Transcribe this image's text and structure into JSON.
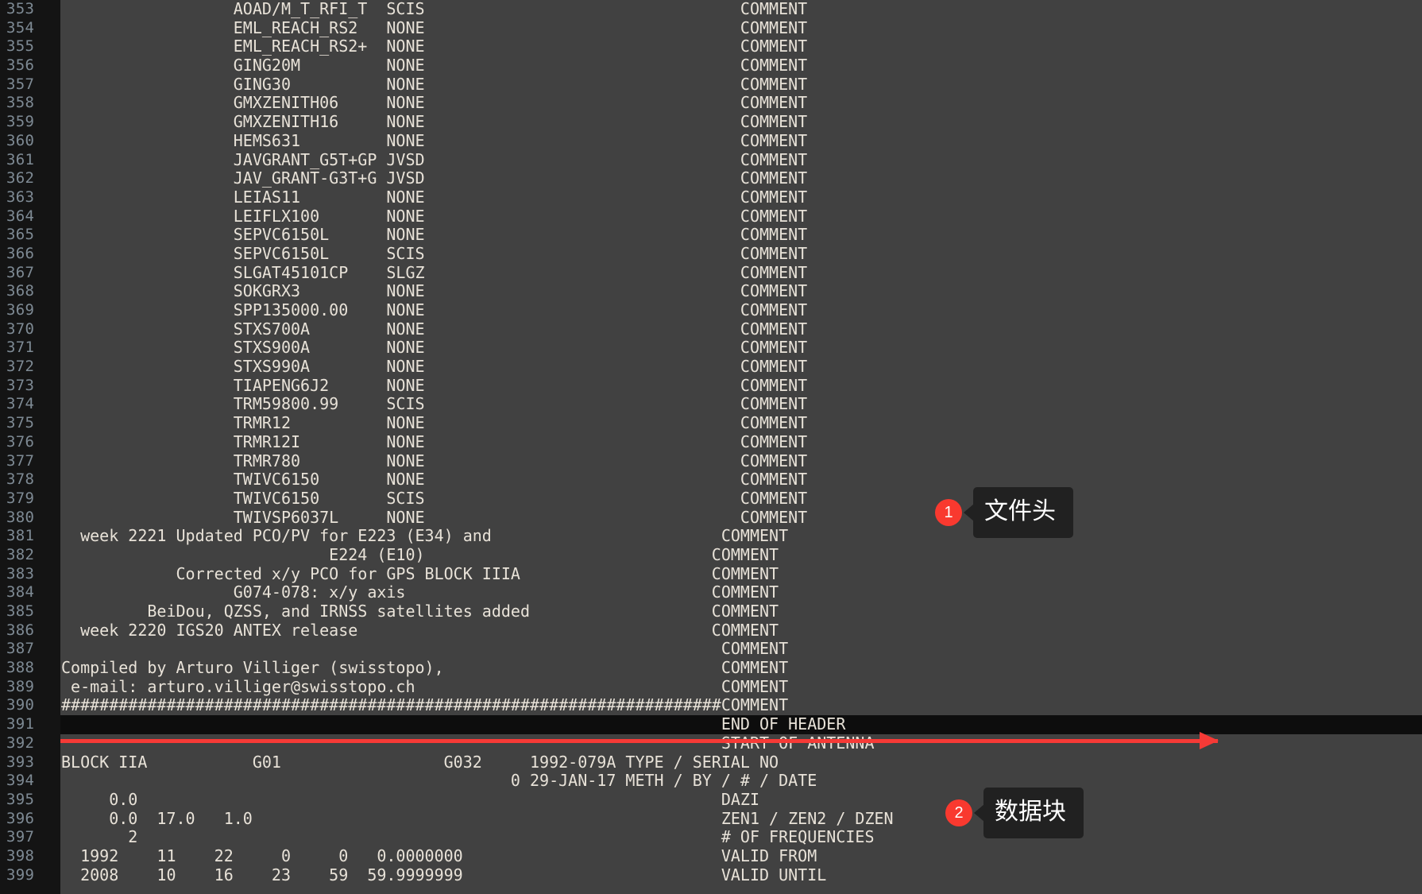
{
  "editor": {
    "first_line_number": 353,
    "gutter_color": "#141414",
    "background_color": "#414141",
    "text_color": "#e8e2d8",
    "line_number_color": "#7e8a94",
    "current_line": 391,
    "lines": [
      {
        "n": 353,
        "text": "                  AOAD/M_T_RFI_T  SCIS                                 COMMENT"
      },
      {
        "n": 354,
        "text": "                  EML_REACH_RS2   NONE                                 COMMENT"
      },
      {
        "n": 355,
        "text": "                  EML_REACH_RS2+  NONE                                 COMMENT"
      },
      {
        "n": 356,
        "text": "                  GING20M         NONE                                 COMMENT"
      },
      {
        "n": 357,
        "text": "                  GING30          NONE                                 COMMENT"
      },
      {
        "n": 358,
        "text": "                  GMXZENITH06     NONE                                 COMMENT"
      },
      {
        "n": 359,
        "text": "                  GMXZENITH16     NONE                                 COMMENT"
      },
      {
        "n": 360,
        "text": "                  HEMS631         NONE                                 COMMENT"
      },
      {
        "n": 361,
        "text": "                  JAVGRANT_G5T+GP JVSD                                 COMMENT"
      },
      {
        "n": 362,
        "text": "                  JAV_GRANT-G3T+G JVSD                                 COMMENT"
      },
      {
        "n": 363,
        "text": "                  LEIAS11         NONE                                 COMMENT"
      },
      {
        "n": 364,
        "text": "                  LEIFLX100       NONE                                 COMMENT"
      },
      {
        "n": 365,
        "text": "                  SEPVC6150L      NONE                                 COMMENT"
      },
      {
        "n": 366,
        "text": "                  SEPVC6150L      SCIS                                 COMMENT"
      },
      {
        "n": 367,
        "text": "                  SLGAT45101CP    SLGZ                                 COMMENT"
      },
      {
        "n": 368,
        "text": "                  SOKGRX3         NONE                                 COMMENT"
      },
      {
        "n": 369,
        "text": "                  SPP135000.00    NONE                                 COMMENT"
      },
      {
        "n": 370,
        "text": "                  STXS700A        NONE                                 COMMENT"
      },
      {
        "n": 371,
        "text": "                  STXS900A        NONE                                 COMMENT"
      },
      {
        "n": 372,
        "text": "                  STXS990A        NONE                                 COMMENT"
      },
      {
        "n": 373,
        "text": "                  TIAPENG6J2      NONE                                 COMMENT"
      },
      {
        "n": 374,
        "text": "                  TRM59800.99     SCIS                                 COMMENT"
      },
      {
        "n": 375,
        "text": "                  TRMR12          NONE                                 COMMENT"
      },
      {
        "n": 376,
        "text": "                  TRMR12I         NONE                                 COMMENT"
      },
      {
        "n": 377,
        "text": "                  TRMR780         NONE                                 COMMENT"
      },
      {
        "n": 378,
        "text": "                  TWIVC6150       NONE                                 COMMENT"
      },
      {
        "n": 379,
        "text": "                  TWIVC6150       SCIS                                 COMMENT"
      },
      {
        "n": 380,
        "text": "                  TWIVSP6037L     NONE                                 COMMENT"
      },
      {
        "n": 381,
        "text": "  week 2221 Updated PCO/PV for E223 (E34) and                        COMMENT"
      },
      {
        "n": 382,
        "text": "                            E224 (E10)                              COMMENT"
      },
      {
        "n": 383,
        "text": "            Corrected x/y PCO for GPS BLOCK IIIA                    COMMENT"
      },
      {
        "n": 384,
        "text": "                  G074-078: x/y axis                                COMMENT"
      },
      {
        "n": 385,
        "text": "         BeiDou, QZSS, and IRNSS satellites added                   COMMENT"
      },
      {
        "n": 386,
        "text": "  week 2220 IGS20 ANTEX release                                     COMMENT"
      },
      {
        "n": 387,
        "text": "                                                                     COMMENT"
      },
      {
        "n": 388,
        "text": "Compiled by Arturo Villiger (swisstopo),                             COMMENT"
      },
      {
        "n": 389,
        "text": " e-mail: arturo.villiger@swisstopo.ch                                COMMENT"
      },
      {
        "n": 390,
        "text": "#####################################################################COMMENT"
      },
      {
        "n": 391,
        "text": "                                                                     END OF HEADER"
      },
      {
        "n": 392,
        "text": "                                                                     START OF ANTENNA"
      },
      {
        "n": 393,
        "text": "BLOCK IIA           G01                 G032     1992-079A TYPE / SERIAL NO"
      },
      {
        "n": 394,
        "text": "                                               0 29-JAN-17 METH / BY / # / DATE"
      },
      {
        "n": 395,
        "text": "     0.0                                                             DAZI"
      },
      {
        "n": 396,
        "text": "     0.0  17.0   1.0                                                 ZEN1 / ZEN2 / DZEN"
      },
      {
        "n": 397,
        "text": "       2                                                             # OF FREQUENCIES"
      },
      {
        "n": 398,
        "text": "  1992    11    22     0     0   0.0000000                           VALID FROM"
      },
      {
        "n": 399,
        "text": "  2008    10    16    23    59  59.9999999                           VALID UNTIL"
      }
    ]
  },
  "annotations": {
    "arrow": {
      "name": "red-underline-arrow",
      "color": "#f63a36",
      "points_to_line": 391
    },
    "callouts": [
      {
        "number": "1",
        "label": "文件头",
        "badge_color": "#f9392f",
        "bubble_color": "#212121"
      },
      {
        "number": "2",
        "label": "数据块",
        "badge_color": "#f9392f",
        "bubble_color": "#212121"
      }
    ]
  }
}
